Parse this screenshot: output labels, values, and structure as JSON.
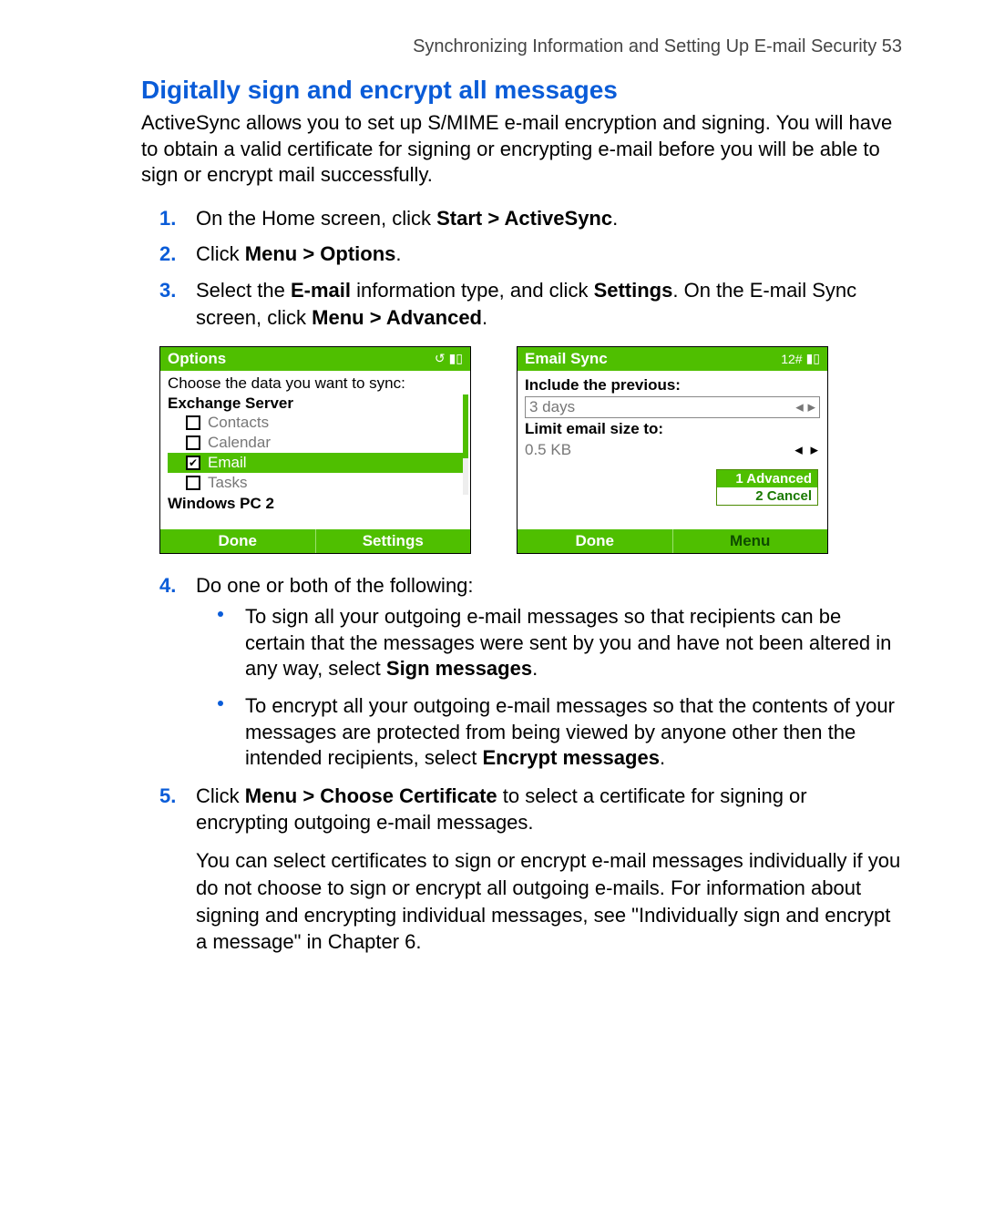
{
  "header": {
    "text": "Synchronizing Information and Setting Up E-mail Security  53"
  },
  "title": "Digitally sign and encrypt all messages",
  "intro": "ActiveSync allows you to set up S/MIME e-mail encryption and signing. You will have to obtain a valid certificate for signing or encrypting e-mail before you will be able to sign or encrypt mail successfully.",
  "steps": {
    "s1": {
      "num": "1.",
      "pre": "On the Home screen, click ",
      "bold": "Start > ActiveSync",
      "post": "."
    },
    "s2": {
      "num": "2.",
      "pre": "Click ",
      "bold": "Menu > Options",
      "post": "."
    },
    "s3": {
      "num": "3.",
      "preA": "Select the ",
      "boldA": "E-mail",
      "midA": " information type, and click ",
      "boldB": "Settings",
      "midB": ". On the E-mail Sync screen, click ",
      "boldC": "Menu > Advanced",
      "post": "."
    },
    "s4": {
      "num": "4.",
      "text": "Do one or both of the following:"
    },
    "b1": {
      "pre": "To sign all your outgoing e-mail messages so that recipients can be certain that the messages were sent by you and have not been altered in any way, select ",
      "bold": "Sign messages",
      "post": "."
    },
    "b2": {
      "pre": "To encrypt all your outgoing e-mail messages so that the contents of your messages are protected from being viewed by anyone other then the intended recipients, select ",
      "bold": "Encrypt messages",
      "post": "."
    },
    "s5": {
      "num": "5.",
      "pre": "Click ",
      "bold": "Menu > Choose Certificate",
      "post": " to select a certificate for signing or encrypting outgoing e-mail messages."
    },
    "note": "You can select certificates to sign or encrypt e-mail messages individually if you do not choose to sign or encrypt all outgoing e-mails. For information about signing and encrypting individual messages, see \"Individually sign and encrypt a message\" in Chapter 6."
  },
  "screen1": {
    "title": "Options",
    "statusIcons": "↺ ▮▯",
    "prompt": "Choose the data you want to sync:",
    "group1": "Exchange Server",
    "items": {
      "contacts": {
        "label": "Contacts",
        "checked": ""
      },
      "calendar": {
        "label": "Calendar",
        "checked": ""
      },
      "email": {
        "label": "Email",
        "checked": "✔"
      },
      "tasks": {
        "label": "Tasks",
        "checked": ""
      }
    },
    "group2": "Windows PC 2",
    "softkeys": {
      "left": "Done",
      "right": "Settings"
    }
  },
  "screen2": {
    "title": "Email Sync",
    "statusText": "12#",
    "label1": "Include the previous:",
    "value1": "3 days",
    "label2": "Limit email size to:",
    "value2": "0.5 KB",
    "menu": {
      "item1": "1 Advanced",
      "item2": "2 Cancel"
    },
    "softkeys": {
      "left": "Done",
      "right": "Menu"
    }
  }
}
